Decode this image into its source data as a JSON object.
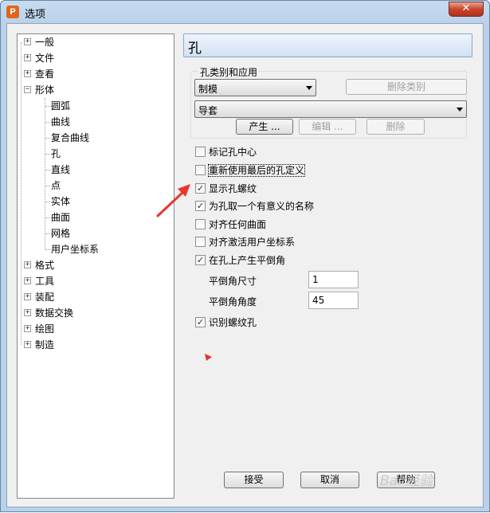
{
  "window": {
    "title": "选项",
    "app_icon": "P",
    "close_label": "✕"
  },
  "tree": {
    "items": [
      {
        "label": "一般",
        "expander": "+"
      },
      {
        "label": "文件",
        "expander": "+"
      },
      {
        "label": "查看",
        "expander": "+"
      },
      {
        "label": "形体",
        "expander": "−"
      },
      {
        "label": "圆弧"
      },
      {
        "label": "曲线"
      },
      {
        "label": "复合曲线"
      },
      {
        "label": "孔"
      },
      {
        "label": "直线"
      },
      {
        "label": "点"
      },
      {
        "label": "实体"
      },
      {
        "label": "曲面"
      },
      {
        "label": "网格"
      },
      {
        "label": "用户坐标系"
      },
      {
        "label": "格式",
        "expander": "+"
      },
      {
        "label": "工具",
        "expander": "+"
      },
      {
        "label": "装配",
        "expander": "+"
      },
      {
        "label": "数据交换",
        "expander": "+"
      },
      {
        "label": "绘图",
        "expander": "+"
      },
      {
        "label": "制造",
        "expander": "+"
      }
    ]
  },
  "panel": {
    "title": "孔",
    "group_label": "孔类别和应用",
    "category_combo": "制模",
    "delete_category_button": "删除类别",
    "application_combo": "导套",
    "generate_button": "产生 ...",
    "edit_button": "编辑 ...",
    "delete_button": "删除",
    "checkboxes": [
      {
        "label": "标记孔中心",
        "checked": false
      },
      {
        "label": "重新使用最后的孔定义",
        "checked": false
      },
      {
        "label": "显示孔螺纹",
        "checked": true
      },
      {
        "label": "为孔取一个有意义的名称",
        "checked": true
      },
      {
        "label": "对齐任何曲面",
        "checked": false
      },
      {
        "label": "对齐激活用户坐标系",
        "checked": false
      },
      {
        "label": "在孔上产生平倒角",
        "checked": true
      }
    ],
    "chamfer_size_label": "平倒角尺寸",
    "chamfer_size_value": "1",
    "chamfer_angle_label": "平倒角角度",
    "chamfer_angle_value": "45",
    "recognize_thread_label": "识别螺纹孔",
    "recognize_thread_checked": true,
    "check_mark": "✓"
  },
  "footer": {
    "accept_button": "接受",
    "cancel_button": "取消",
    "help_button": "帮助"
  },
  "watermark": "Bai 经验",
  "colors": {
    "annotation_arrow": "#e8362b",
    "close_button": "#c9452c"
  }
}
